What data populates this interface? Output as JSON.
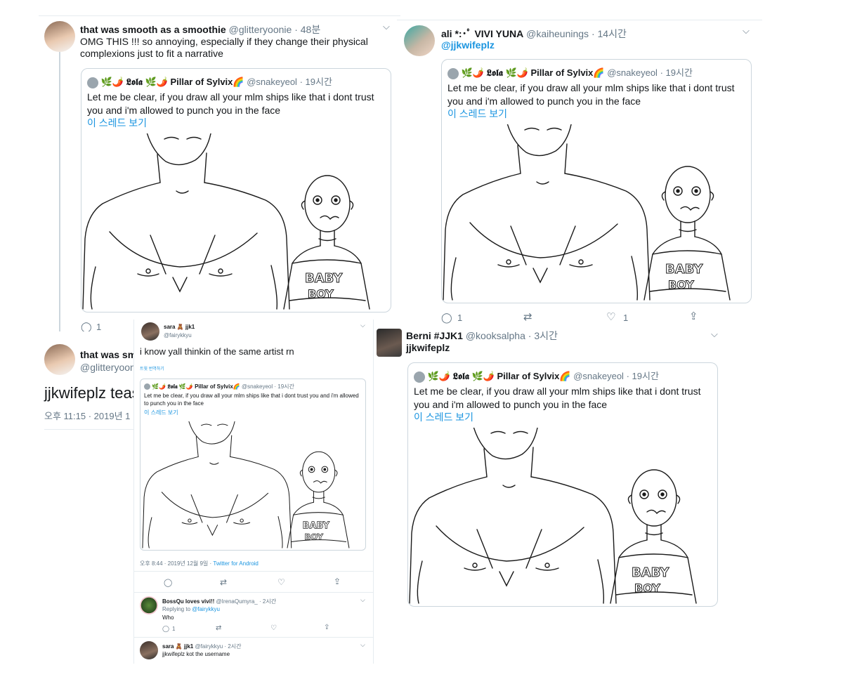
{
  "panel1": {
    "name": "that was smooth as a smoothie",
    "handle": "@glitteryoonie",
    "time": "48분",
    "text": "OMG THIS !!! so annoying, especially if they change their physical complexions just to fit a narrative",
    "quote": {
      "emoji_name": "🌿🌶️ 𝕷𝖔𝖑𝖆 🌿🌶️",
      "name": "Pillar of Sylvix🌈",
      "handle": "@snakeyeol",
      "time": "19시간",
      "text": "Let me be clear, if you draw all your mlm ships like that i dont trust you and i'm allowed to punch you in the face",
      "thread_link": "이 스레드 보기",
      "shirt_line1": "BABY",
      "shirt_line2": "BOY"
    },
    "reply_count": "1",
    "second": {
      "name": "that was smc",
      "handle": "@glitteryoon",
      "text": "jjkwifeplz teas",
      "time": "오후 11:15 · 2019년 1"
    }
  },
  "panel2": {
    "name": "ali *:･ﾟ VIVI YUNA",
    "handle": "@kaiheunings",
    "time": "14시간",
    "mention": "@jjkwifeplz",
    "quote": {
      "emoji_name": "🌿🌶️ 𝕷𝖔𝖑𝖆 🌿🌶️",
      "name": "Pillar of Sylvix🌈",
      "handle": "@snakeyeol",
      "time": "19시간",
      "text": "Let me be clear, if you draw all your mlm ships like that i dont trust you and i'm allowed to punch you in the face",
      "thread_link": "이 스레드 보기",
      "shirt_line1": "BABY",
      "shirt_line2": "BOY"
    },
    "reply_count": "1",
    "like_count": "1"
  },
  "panel3": {
    "name": "sara 🧸 jjk1",
    "handle": "@fairykkyu",
    "text": "i know yall thinkin of the same artist rn",
    "translate": "트윗 번역하기",
    "quote": {
      "emoji_name": "🌿🌶️ 𝕷𝖔𝖑𝖆 🌿🌶️",
      "name": "Pillar of Sylvix🌈",
      "handle": "@snakeyeol",
      "time": "19시간",
      "text": "Let me be clear, if you draw all your mlm ships like that i dont trust you and i'm allowed to punch you in the face",
      "thread_link": "이 스레드 보기",
      "shirt_line1": "BABY",
      "shirt_line2": "BOY"
    },
    "meta": "오후 8:44 · 2019년 12월 9일 · ",
    "source": "Twitter for Android",
    "reply1": {
      "name": "BossQu loves vivi!!",
      "handle": "@IrenaQumyra_",
      "time": "2시간",
      "replying_prefix": "Replying to ",
      "replying_handle": "@fairykkyu",
      "text": "Who",
      "reply_count": "1"
    },
    "reply2": {
      "name": "sara 🧸 jjk1",
      "handle": "@fairykkyu",
      "time": "2시간",
      "text": "jjkwifeplz kot the username"
    }
  },
  "panel4": {
    "name": "Berni #JJK1",
    "handle": "@kooksalpha",
    "time": "3시간",
    "mention": "jjkwifeplz",
    "quote": {
      "emoji_name": "🌿🌶️ 𝕷𝖔𝖑𝖆 🌿🌶️",
      "name": "Pillar of Sylvix🌈",
      "handle": "@snakeyeol",
      "time": "19시간",
      "text": "Let me be clear, if you draw all your mlm ships like that i dont trust you and i'm allowed to punch you in the face",
      "thread_link": "이 스레드 보기",
      "shirt_line1": "BABY",
      "shirt_line2": "BOY"
    }
  },
  "icons": {
    "reply": "reply-icon",
    "retweet": "retweet-icon",
    "like": "heart-icon",
    "share": "share-icon",
    "more": "chevron-down-icon"
  },
  "colors": {
    "link": "#1b95e0",
    "text": "#14171a",
    "muted": "#657786",
    "border": "#ccd6dd"
  }
}
